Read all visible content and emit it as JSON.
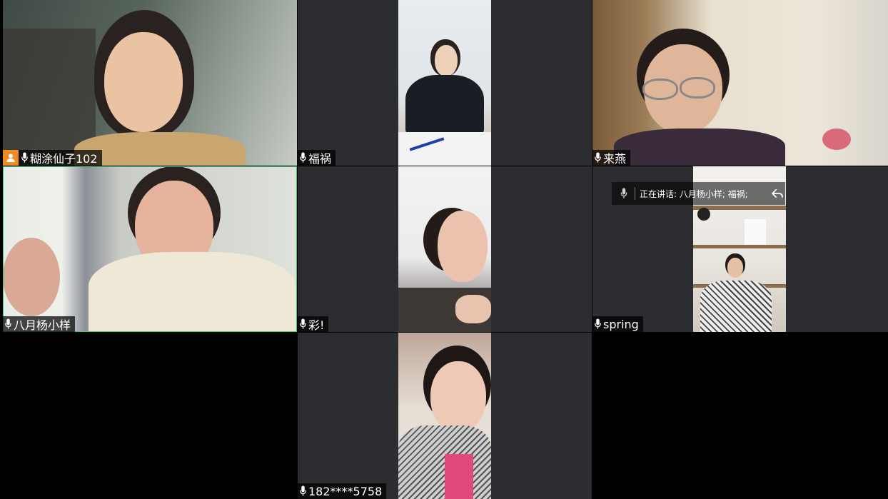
{
  "participants": [
    {
      "name": "糊涂仙子102",
      "is_host": true
    },
    {
      "name": "福祸"
    },
    {
      "name": "来燕"
    },
    {
      "name": "八月杨小样",
      "active_speaker": true
    },
    {
      "name": "彩!"
    },
    {
      "name": "spring"
    },
    {
      "name": "182****5758"
    }
  ],
  "speaking_indicator": {
    "text": "正在讲话: 八月杨小样; 福祸;"
  },
  "colors": {
    "tile_bg": "#2b2d30",
    "name_tag_bg": "rgba(0,0,0,0.72)",
    "host_badge": "#f08a24",
    "active_border": "#3fc96f"
  }
}
